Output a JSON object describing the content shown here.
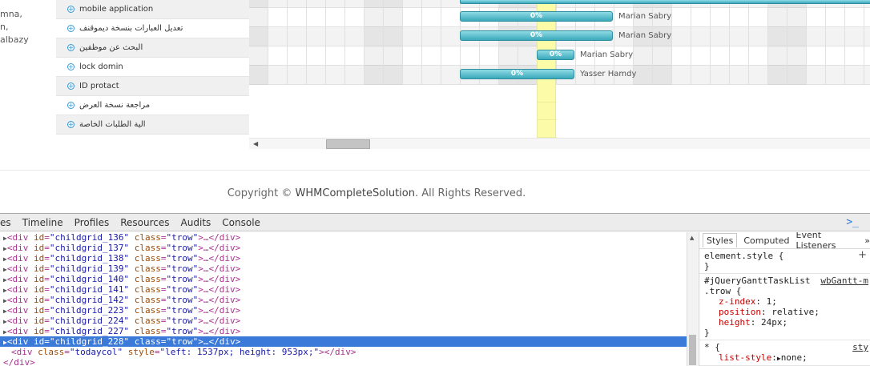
{
  "left_names": [
    "mna,",
    "n,",
    "albazy"
  ],
  "tasks": [
    {
      "name": "mobile application"
    },
    {
      "name": "تعديل العبارات بنسخة ديموقنف"
    },
    {
      "name": "البحث عن موظفين"
    },
    {
      "name": "lock domin"
    },
    {
      "name": "ID protact"
    },
    {
      "name": "مراجعة نسخة العرض"
    },
    {
      "name": "الية الطلبات الخاصة"
    }
  ],
  "gantt_bars": [
    {
      "percent": "0%",
      "owner": "Marian Sabry"
    },
    {
      "percent": "0%",
      "owner": "Marian Sabry"
    },
    {
      "percent": "0%",
      "owner": "Marian Sabry"
    },
    {
      "percent": "0%",
      "owner": "Yasser Hamdy"
    }
  ],
  "footer": {
    "prefix": "Copyright © ",
    "brand": "WHMCompleteSolution",
    "suffix": ". All Rights Reserved."
  },
  "devtools": {
    "tabs": [
      "es",
      "Timeline",
      "Profiles",
      "Resources",
      "Audits",
      "Console"
    ],
    "console_icon": "terminal-icon",
    "nodes": [
      {
        "id": "childgrid_136",
        "cls": "trow"
      },
      {
        "id": "childgrid_137",
        "cls": "trow"
      },
      {
        "id": "childgrid_138",
        "cls": "trow"
      },
      {
        "id": "childgrid_139",
        "cls": "trow"
      },
      {
        "id": "childgrid_140",
        "cls": "trow"
      },
      {
        "id": "childgrid_141",
        "cls": "trow"
      },
      {
        "id": "childgrid_142",
        "cls": "trow"
      },
      {
        "id": "childgrid_223",
        "cls": "trow"
      },
      {
        "id": "childgrid_224",
        "cls": "trow"
      },
      {
        "id": "childgrid_227",
        "cls": "trow"
      },
      {
        "id": "childgrid_228",
        "cls": "trow",
        "selected": true
      }
    ],
    "todaycol": {
      "cls": "todaycol",
      "style": "left: 1537px; height: 953px;"
    },
    "closing_tag": "</div>",
    "styles": {
      "tabs": [
        "Styles",
        "Computed",
        "Event Listeners",
        "»"
      ],
      "element_style": "element.style {",
      "element_close": "}",
      "rule_selector1": "#jQueryGanttTaskList",
      "rule_source1": "wbGantt-m",
      "rule_selector2": ".trow {",
      "rule_props": [
        {
          "name": "z-index",
          "value": "1;"
        },
        {
          "name": "position",
          "value": "relative;"
        },
        {
          "name": "height",
          "value": "24px;"
        }
      ],
      "rule_close": "}",
      "universal_selector": "* {",
      "universal_source": "sty",
      "universal_prop": {
        "name": "list-style",
        "value": "none;"
      }
    }
  }
}
